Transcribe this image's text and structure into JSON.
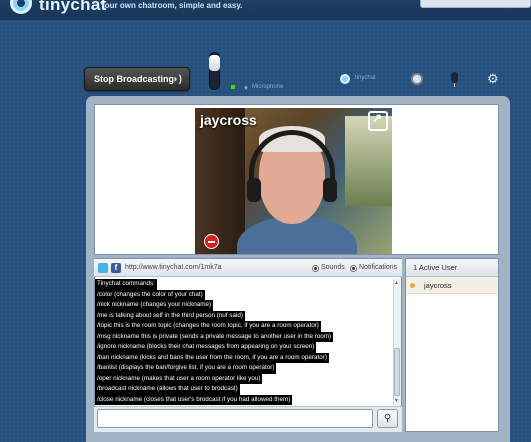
{
  "header": {
    "logo_text": "tinychat",
    "tagline": "Your own chatroom, simple and easy."
  },
  "toolbar": {
    "stop_broadcast_label": "Stop Broadcasting",
    "microphone_label": "Microphone",
    "tinychat_label": "tinychat"
  },
  "video": {
    "name": "jaycross"
  },
  "chat": {
    "link": "http://www.tinychat.com/1mk7a",
    "sounds_label": "Sounds",
    "notifications_label": "Notifications",
    "input_placeholder": "",
    "lines": [
      "Tinychat commands:",
      "/color (changes the color of your chat)",
      "/nick nickname (changes your nickname)",
      "/me is talking about self in the third person (nuf said)",
      "/topic this is the room topic (changes the room topic, if you are a room operator)",
      "/msg nickname this is private (sends a private message to another user in the room)",
      "/ignore nickname (blocks their chat messages from appearing on your screen)",
      "/ban nickname (kicks and bans the user from the room, if you are a room operator)",
      "/banlist (displays the ban/forgive list, if you are a room operator)",
      "/oper nickname (makes that user a room operator like you)",
      "/broadcast nickname (allows that user to brodcast)",
      "/close nickname (closes that user's brodcast if you had allowed them)"
    ]
  },
  "users": {
    "header": "1 Active User",
    "list": [
      "jaycross"
    ]
  },
  "icons": {
    "broadcast_icon": "speaker-waves",
    "gear_icon": "gear",
    "camera_icon": "webcam",
    "mic_icon": "microphone",
    "send_icon": "magnifier"
  }
}
